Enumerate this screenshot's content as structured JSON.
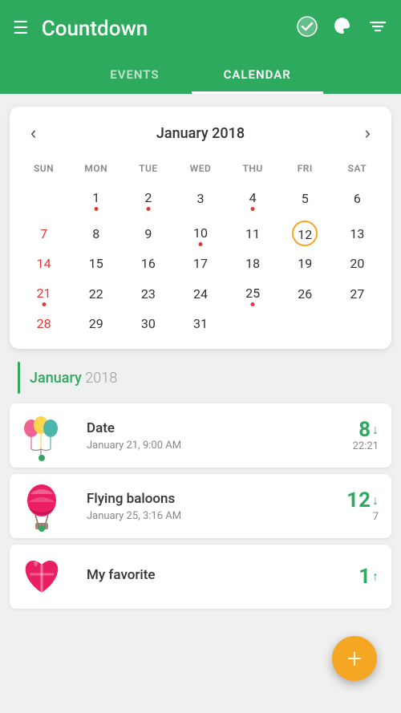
{
  "header": {
    "title": "Countdown",
    "menu_icon": "☰",
    "check_icon": "✓",
    "palette_icon": "🎨",
    "filter_icon": "≡"
  },
  "tabs": [
    {
      "label": "EVENTS",
      "active": false
    },
    {
      "label": "CALENDAR",
      "active": true
    }
  ],
  "calendar": {
    "month_title": "January 2018",
    "prev_label": "‹",
    "next_label": "›",
    "weekdays": [
      "SUN",
      "MON",
      "TUE",
      "WED",
      "THU",
      "FRI",
      "SAT"
    ],
    "today_day": "12"
  },
  "month_label": {
    "month": "January",
    "year": "2018"
  },
  "events": [
    {
      "id": "date-event",
      "title": "Date",
      "date": "January 21, 9:00 AM",
      "days": "8",
      "days_arrow": "↓",
      "time": "22:21",
      "icon_type": "balloons"
    },
    {
      "id": "flying-baloons",
      "title": "Flying baloons",
      "date": "January 25, 3:16 AM",
      "days": "12",
      "days_arrow": "↓",
      "time": "7",
      "icon_type": "hotair"
    },
    {
      "id": "my-favorite",
      "title": "My favorite",
      "date": "",
      "days": "1",
      "days_arrow": "↑",
      "time": "",
      "icon_type": "heart"
    }
  ],
  "fab": {
    "label": "+"
  },
  "colors": {
    "primary": "#2eaa5e",
    "accent": "#f5a623",
    "red": "#e53935"
  }
}
